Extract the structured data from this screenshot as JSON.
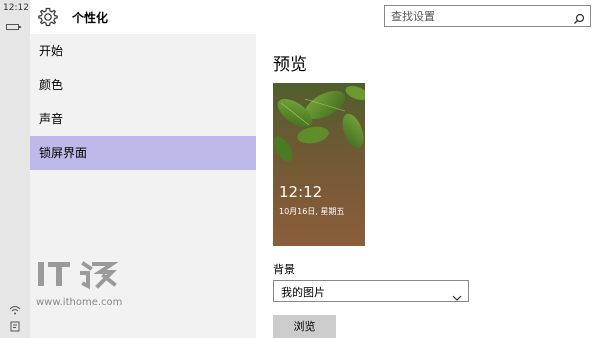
{
  "system": {
    "clock": "12:12"
  },
  "header": {
    "title": "个性化",
    "icon": "gear-icon",
    "search": {
      "placeholder": "查找设置",
      "value": ""
    }
  },
  "sidebar": {
    "items": [
      {
        "label": "开始",
        "selected": false
      },
      {
        "label": "颜色",
        "selected": false
      },
      {
        "label": "声音",
        "selected": false
      },
      {
        "label": "锁屏界面",
        "selected": true
      }
    ],
    "selected_color": "#bdb9e8"
  },
  "watermark": {
    "url": "www.ithome.com"
  },
  "main": {
    "section_title": "预览",
    "preview": {
      "time": "12:12",
      "date": "10月16日, 星期五"
    },
    "background": {
      "label": "背景",
      "selected": "我的图片"
    },
    "browse_label": "浏览"
  }
}
